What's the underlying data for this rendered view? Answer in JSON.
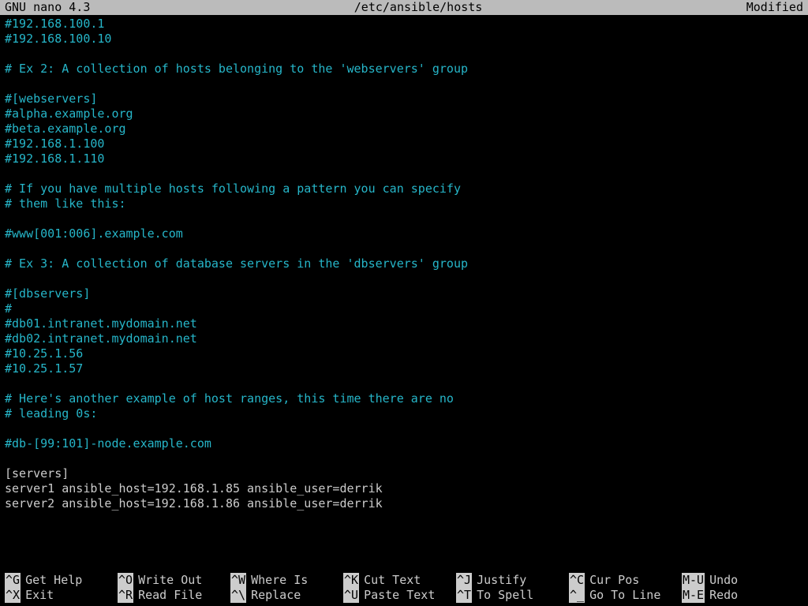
{
  "titlebar": {
    "app": "GNU nano 4.3",
    "file": "/etc/ansible/hosts",
    "status": "Modified"
  },
  "lines": [
    {
      "cls": "",
      "text": "#192.168.100.1"
    },
    {
      "cls": "",
      "text": "#192.168.100.10"
    },
    {
      "cls": "",
      "text": ""
    },
    {
      "cls": "",
      "text": "# Ex 2: A collection of hosts belonging to the 'webservers' group"
    },
    {
      "cls": "",
      "text": ""
    },
    {
      "cls": "",
      "text": "#[webservers]"
    },
    {
      "cls": "",
      "text": "#alpha.example.org"
    },
    {
      "cls": "",
      "text": "#beta.example.org"
    },
    {
      "cls": "",
      "text": "#192.168.1.100"
    },
    {
      "cls": "",
      "text": "#192.168.1.110"
    },
    {
      "cls": "",
      "text": ""
    },
    {
      "cls": "",
      "text": "# If you have multiple hosts following a pattern you can specify"
    },
    {
      "cls": "",
      "text": "# them like this:"
    },
    {
      "cls": "",
      "text": ""
    },
    {
      "cls": "",
      "text": "#www[001:006].example.com"
    },
    {
      "cls": "",
      "text": ""
    },
    {
      "cls": "",
      "text": "# Ex 3: A collection of database servers in the 'dbservers' group"
    },
    {
      "cls": "",
      "text": ""
    },
    {
      "cls": "",
      "text": "#[dbservers]"
    },
    {
      "cls": "",
      "text": "#"
    },
    {
      "cls": "",
      "text": "#db01.intranet.mydomain.net"
    },
    {
      "cls": "",
      "text": "#db02.intranet.mydomain.net"
    },
    {
      "cls": "",
      "text": "#10.25.1.56"
    },
    {
      "cls": "",
      "text": "#10.25.1.57"
    },
    {
      "cls": "",
      "text": ""
    },
    {
      "cls": "",
      "text": "# Here's another example of host ranges, this time there are no"
    },
    {
      "cls": "",
      "text": "# leading 0s:"
    },
    {
      "cls": "",
      "text": ""
    },
    {
      "cls": "",
      "text": "#db-[99:101]-node.example.com"
    },
    {
      "cls": "",
      "text": ""
    },
    {
      "cls": "white",
      "text": "[servers]"
    },
    {
      "cls": "white",
      "text": "server1 ansible_host=192.168.1.85 ansible_user=derrik"
    },
    {
      "cls": "white",
      "text": "server2 ansible_host=192.168.1.86 ansible_user=derrik"
    }
  ],
  "shortcuts": {
    "row1": [
      {
        "key": "^G",
        "label": "Get Help"
      },
      {
        "key": "^O",
        "label": "Write Out"
      },
      {
        "key": "^W",
        "label": "Where Is"
      },
      {
        "key": "^K",
        "label": "Cut Text"
      },
      {
        "key": "^J",
        "label": "Justify"
      },
      {
        "key": "^C",
        "label": "Cur Pos"
      },
      {
        "key": "M-U",
        "label": "Undo"
      }
    ],
    "row2": [
      {
        "key": "^X",
        "label": "Exit"
      },
      {
        "key": "^R",
        "label": "Read File"
      },
      {
        "key": "^\\",
        "label": "Replace"
      },
      {
        "key": "^U",
        "label": "Paste Text"
      },
      {
        "key": "^T",
        "label": "To Spell"
      },
      {
        "key": "^_",
        "label": "Go To Line"
      },
      {
        "key": "M-E",
        "label": "Redo"
      }
    ]
  }
}
